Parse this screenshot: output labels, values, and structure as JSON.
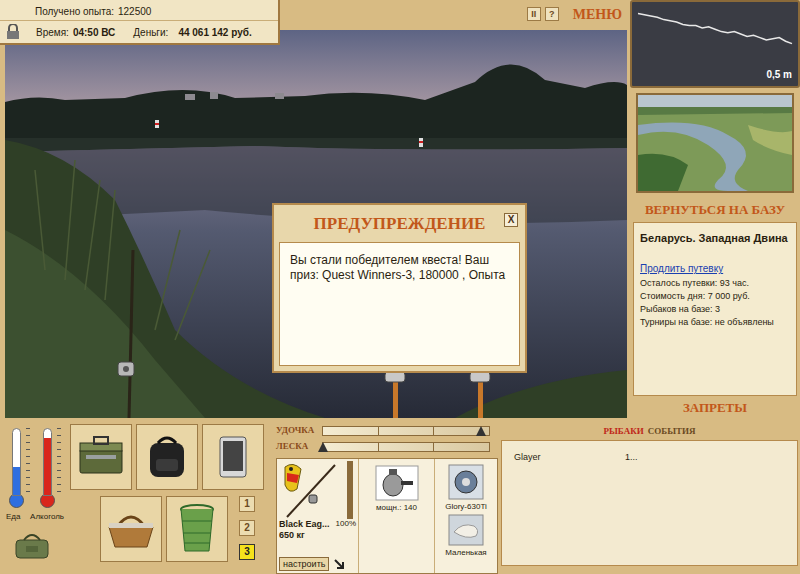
{
  "info": {
    "experience_label": "Получено опыта:",
    "experience": "122500",
    "time_label": "Время:",
    "time": "04:50 ВС",
    "money_label": "Деньги:",
    "money": "44 061 142 руб."
  },
  "toolbar": {
    "pause": "II",
    "help": "?",
    "menu": "МЕНЮ"
  },
  "depth": {
    "reading": "0,5 m",
    "profile": [
      0.3,
      0.4,
      0.5,
      0.6,
      0.8,
      0.9,
      1.0,
      1.2,
      1.3,
      1.3,
      1.5,
      1.4,
      1.6,
      1.8,
      1.9,
      1.8,
      2.0,
      2.2,
      2.1,
      2.3,
      2.5,
      2.4,
      2.3,
      2.6,
      2.8
    ]
  },
  "dialog": {
    "title": "ПРЕДУПРЕЖДЕНИЕ",
    "close": "X",
    "message": "Вы стали победителем квеста! Ваш приз: Quest Winners-3, 180000 , Опыта"
  },
  "location": {
    "return": "ВЕРНУТЬСЯ НА БАЗУ",
    "name": "Беларусь. Западная Двина",
    "extend": "Продлить путевку",
    "details": [
      "Осталось путевки: 93 час.",
      "Стоимость дня: 7 000 руб.",
      "Рыбаков на базе: 3",
      "Турниры на базе: не объявлены"
    ],
    "bans": "ЗАПРЕТЫ"
  },
  "gauges": [
    {
      "label": "Еда",
      "level": 0.42,
      "color": "#2f6fe0"
    },
    {
      "label": "Алкоголь",
      "level": 0.86,
      "color": "#d9261c"
    }
  ],
  "rods": [
    {
      "label": "1",
      "selected": false
    },
    {
      "label": "2",
      "selected": false
    },
    {
      "label": "3",
      "selected": true
    }
  ],
  "tension": [
    {
      "label": "УДОЧКА",
      "level": 0.95
    },
    {
      "label": "ЛЕСКА",
      "level": 0
    }
  ],
  "tackle": {
    "rod_name": "Black Eag...",
    "rod_weight": "650 кг",
    "rod_condition": "100%",
    "rod_level": 1,
    "setup": "настроить",
    "reel_power": "мощн.: 140",
    "line": "Glory-630Ti",
    "bait": "Маленькая"
  },
  "events": {
    "tabs": [
      {
        "label": "РЫБАКИ",
        "selected": true
      },
      {
        "label": "СОБЫТИЯ",
        "selected": false
      }
    ],
    "rows": [
      [
        "Glayer",
        "1..."
      ]
    ]
  }
}
